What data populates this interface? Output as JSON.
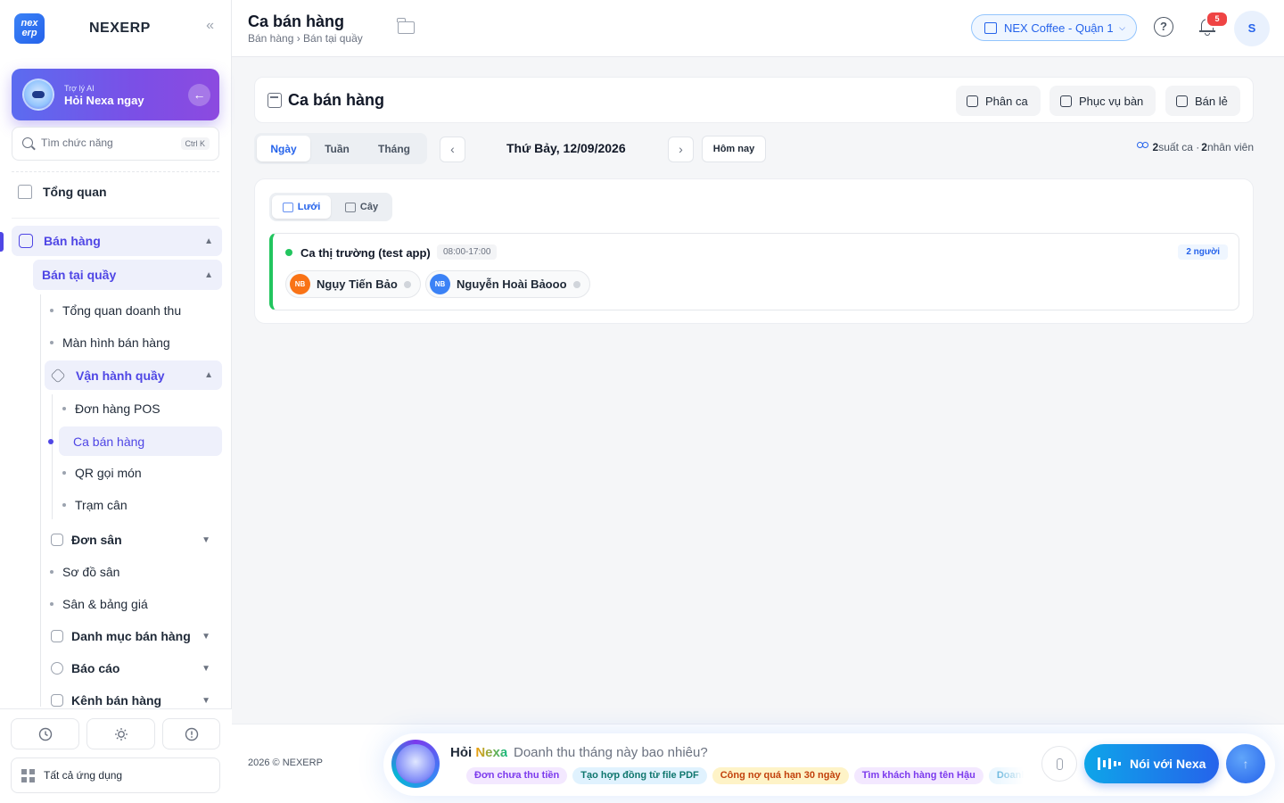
{
  "app": {
    "logo_text_top": "nex",
    "logo_text_bottom": "erp",
    "name": "NEXERP",
    "collapse_icon": "«"
  },
  "ai_card": {
    "small_label": "Trợ lý AI",
    "big_label": "Hỏi Nexa ngay",
    "arrow": "←"
  },
  "search": {
    "placeholder": "Tìm chức năng",
    "shortcut": "Ctrl K"
  },
  "sidebar": {
    "overview": "Tổng quan",
    "sales": "Bán hàng",
    "counter_sales": "Bán tại quầy",
    "revenue_overview": "Tổng quan doanh thu",
    "sales_screen": "Màn hình bán hàng",
    "counter_ops": "Vận hành quầy",
    "pos_orders": "Đơn hàng POS",
    "sales_shift": "Ca bán hàng",
    "qr_order": "QR gọi món",
    "weigh_station": "Trạm cân",
    "court_orders": "Đơn sân",
    "court_map": "Sơ đồ sân",
    "court_prices": "Sân & bảng giá",
    "sales_catalog": "Danh mục bán hàng",
    "reports": "Báo cáo",
    "sales_channels": "Kênh bán hàng",
    "caret_up": "▲",
    "caret_down": "▼",
    "all_apps": "Tất cả ứng dụng",
    "bottom_icons": [
      "clock-icon",
      "sun-icon",
      "alert-icon"
    ]
  },
  "header": {
    "title": "Ca bán hàng",
    "breadcrumb": "Bán hàng › Bán tại quầy",
    "store": "NEX Coffee - Quận 1",
    "store_chevron": "⌵",
    "help": "?",
    "notifications_count": "5",
    "user_initial": "S"
  },
  "main": {
    "card_title": "Ca bán hàng",
    "actions": [
      "Phân ca",
      "Phục vụ bàn",
      "Bán lẻ"
    ],
    "period_tabs": [
      "Ngày",
      "Tuần",
      "Tháng"
    ],
    "active_period": "Ngày",
    "prev": "‹",
    "next": "›",
    "date": "Thứ Bảy, 12/09/2026",
    "today": "Hôm nay",
    "summary_shifts_count": "2",
    "summary_shifts_label": "suất ca ·",
    "summary_staff_count": "2",
    "summary_staff_label": "nhân viên",
    "view_modes": [
      "Lưới",
      "Cây"
    ],
    "active_view": "Lưới",
    "shift": {
      "name": "Ca thị trường (test app)",
      "time": "08:00-17:00",
      "people": "2 người",
      "status_color": "#22c55e",
      "employees": [
        {
          "initials": "NB",
          "name": "Ngụy Tiến Bảo",
          "color": "#f97316"
        },
        {
          "initials": "NB",
          "name": "Nguyễn Hoài Bảooo",
          "color": "#3b82f6"
        }
      ]
    }
  },
  "footer": {
    "copyright": "2026 © NEXERP"
  },
  "assistant": {
    "title_prefix": "Hỏi",
    "title_brand": "Nexa",
    "placeholder": "Doanh thu tháng này bao nhiêu?",
    "chips": [
      {
        "label": "Đơn chưa thu tiền",
        "color": "#7c3aed",
        "bg": "#f3e8ff"
      },
      {
        "label": "Tạo hợp đồng từ file PDF",
        "color": "#0f766e",
        "bg": "#e0f2fe"
      },
      {
        "label": "Công nợ quá hạn 30 ngày",
        "color": "#c2410c",
        "bg": "#fef3c7"
      },
      {
        "label": "Tìm khách hàng tên Hậu",
        "color": "#7c3aed",
        "bg": "#f3e8ff"
      },
      {
        "label": "Doanh",
        "color": "#0284c7",
        "bg": "#e0f2fe"
      }
    ],
    "voice_label": "Nói với Nexa",
    "send_icon": "↑"
  }
}
